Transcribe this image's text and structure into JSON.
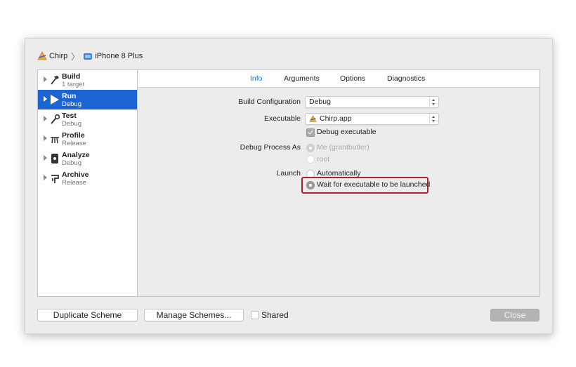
{
  "breadcrumb": {
    "scheme": "Chirp",
    "separator": "〉",
    "destination": "iPhone 8 Plus",
    "scheme_icon": "xcode-app-icon",
    "destination_icon": "iphone-icon"
  },
  "sidebar": {
    "items": [
      {
        "name": "Build",
        "sub": "1 target",
        "icon": "hammer-icon"
      },
      {
        "name": "Run",
        "sub": "Debug",
        "icon": "play-icon"
      },
      {
        "name": "Test",
        "sub": "Debug",
        "icon": "wrench-icon"
      },
      {
        "name": "Profile",
        "sub": "Release",
        "icon": "instruments-icon"
      },
      {
        "name": "Analyze",
        "sub": "Debug",
        "icon": "analyze-icon"
      },
      {
        "name": "Archive",
        "sub": "Release",
        "icon": "archive-icon"
      }
    ],
    "selected": "Run"
  },
  "tabs": [
    "Info",
    "Arguments",
    "Options",
    "Diagnostics"
  ],
  "active_tab": "Info",
  "form": {
    "build_config_label": "Build Configuration",
    "build_config_value": "Debug",
    "executable_label": "Executable",
    "executable_value": "Chirp.app",
    "debug_executable_label": "Debug executable",
    "debug_process_label": "Debug Process As",
    "debug_process_me": "Me (grantbutler)",
    "debug_process_root": "root",
    "launch_label": "Launch",
    "launch_auto": "Automatically",
    "launch_wait": "Wait for executable to be launched"
  },
  "footer": {
    "duplicate": "Duplicate Scheme",
    "manage": "Manage Schemes...",
    "shared": "Shared",
    "close": "Close"
  },
  "colors": {
    "selection": "#1c64d2",
    "active_tab": "#1a74e8",
    "highlight_border": "#a8262c"
  }
}
